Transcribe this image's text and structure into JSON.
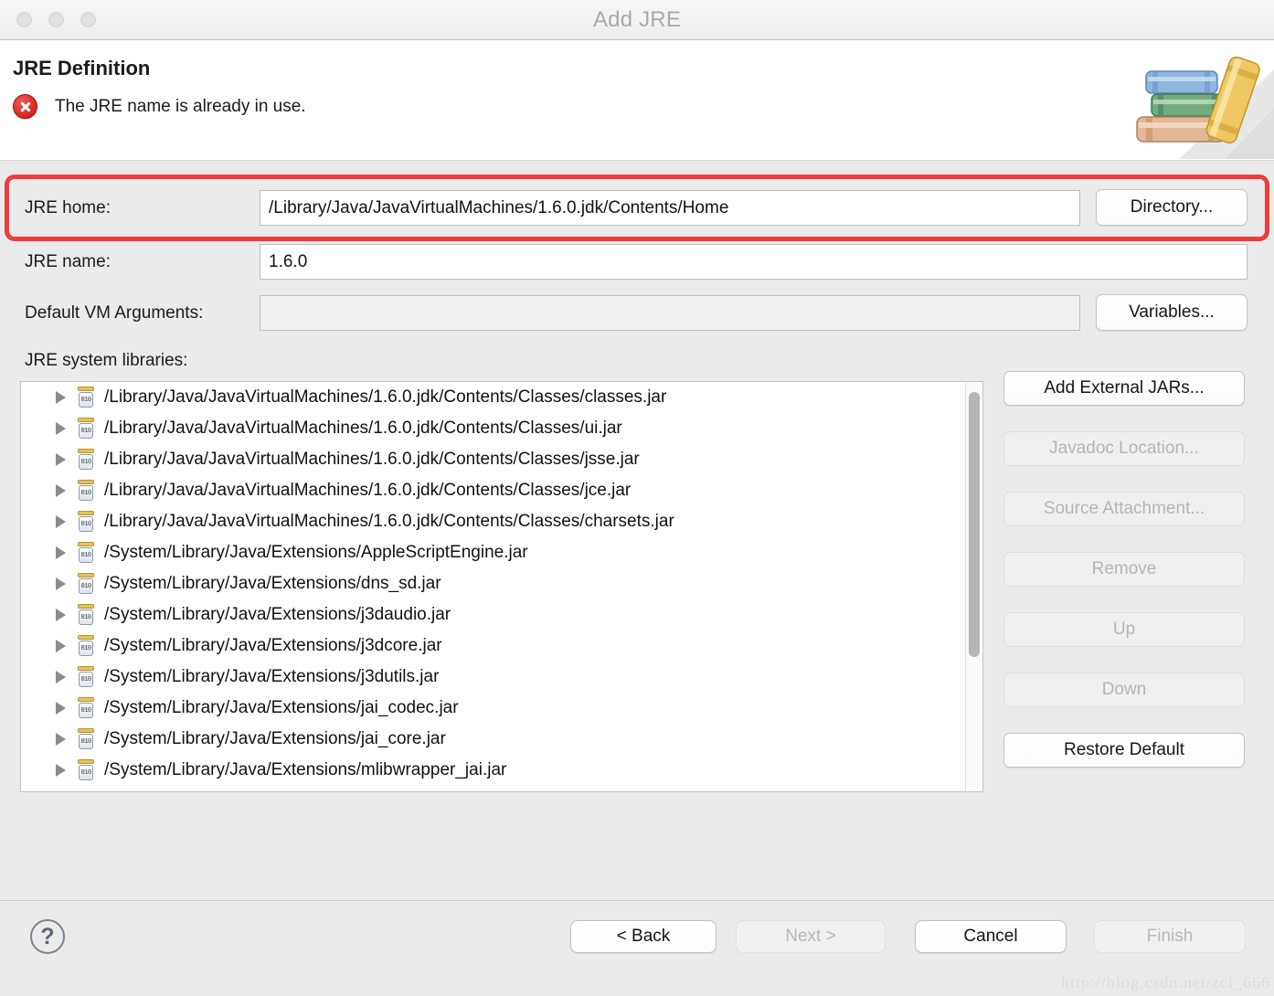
{
  "window": {
    "title": "Add JRE",
    "traffic_lights": [
      "close-button",
      "minimize-button",
      "zoom-button"
    ]
  },
  "header": {
    "title": "JRE Definition",
    "error_message": "The JRE name is already in use.",
    "error_icon": "error-circle-icon",
    "decoration_icon": "books-stack-icon"
  },
  "form": {
    "jre_home": {
      "label": "JRE home:",
      "value": "/Library/Java/JavaVirtualMachines/1.6.0.jdk/Contents/Home",
      "placeholder": "",
      "button": "Directory...",
      "highlighted": true,
      "highlight_color": "#ef3d3d"
    },
    "jre_name": {
      "label": "JRE name:",
      "value": "1.6.0",
      "placeholder": ""
    },
    "vm_args": {
      "label": "Default VM Arguments:",
      "value": "",
      "placeholder": "",
      "button": "Variables..."
    },
    "libraries_label": "JRE system libraries:"
  },
  "libraries": [
    "/Library/Java/JavaVirtualMachines/1.6.0.jdk/Contents/Classes/classes.jar",
    "/Library/Java/JavaVirtualMachines/1.6.0.jdk/Contents/Classes/ui.jar",
    "/Library/Java/JavaVirtualMachines/1.6.0.jdk/Contents/Classes/jsse.jar",
    "/Library/Java/JavaVirtualMachines/1.6.0.jdk/Contents/Classes/jce.jar",
    "/Library/Java/JavaVirtualMachines/1.6.0.jdk/Contents/Classes/charsets.jar",
    "/System/Library/Java/Extensions/AppleScriptEngine.jar",
    "/System/Library/Java/Extensions/dns_sd.jar",
    "/System/Library/Java/Extensions/j3daudio.jar",
    "/System/Library/Java/Extensions/j3dcore.jar",
    "/System/Library/Java/Extensions/j3dutils.jar",
    "/System/Library/Java/Extensions/jai_codec.jar",
    "/System/Library/Java/Extensions/jai_core.jar",
    "/System/Library/Java/Extensions/mlibwrapper_jai.jar"
  ],
  "library_icon_label": "010",
  "side_buttons": [
    {
      "label": "Add External JARs...",
      "enabled": true
    },
    {
      "label": "Javadoc Location...",
      "enabled": false
    },
    {
      "label": "Source Attachment...",
      "enabled": false
    },
    {
      "label": "Remove",
      "enabled": false
    },
    {
      "label": "Up",
      "enabled": false
    },
    {
      "label": "Down",
      "enabled": false
    },
    {
      "label": "Restore Default",
      "enabled": true
    }
  ],
  "footer": {
    "help_icon": "question-mark-icon",
    "help_glyph": "?",
    "buttons": [
      {
        "label": "< Back",
        "enabled": true
      },
      {
        "label": "Next >",
        "enabled": false
      },
      {
        "label": "Cancel",
        "enabled": true
      },
      {
        "label": "Finish",
        "enabled": false
      }
    ]
  },
  "watermark": "http://blog.csdn.net/zcl_666"
}
